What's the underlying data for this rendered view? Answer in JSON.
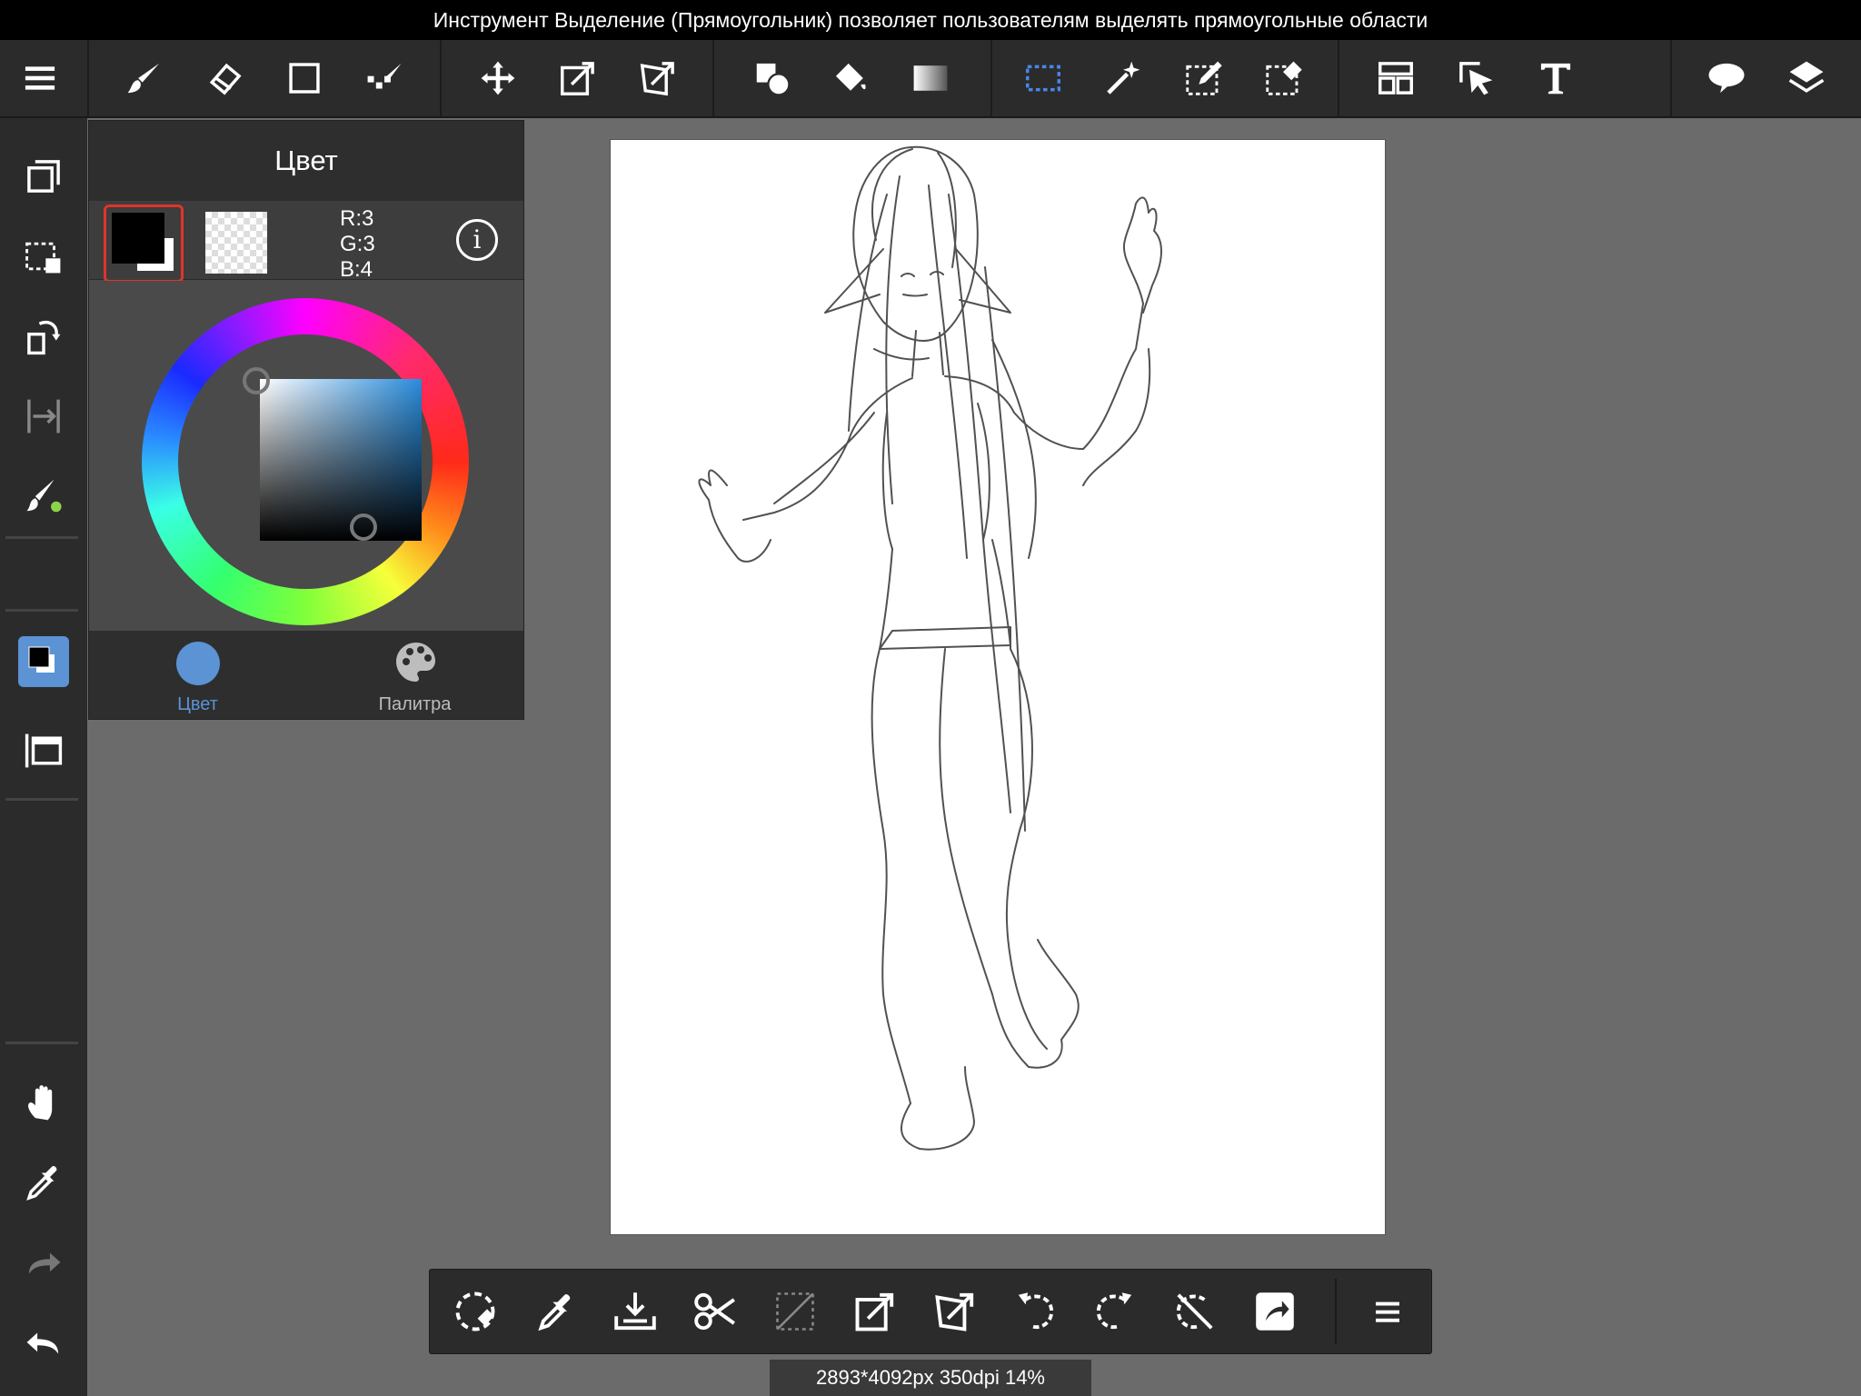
{
  "hint_bar": {
    "text": "Инструмент Выделение (Прямоугольник) позволяет пользователям выделять прямоугольные области"
  },
  "toolbar": {
    "tools": [
      "menu-icon",
      "brush-icon",
      "eraser-icon",
      "shape-icon",
      "dot-brush-icon",
      "move-icon",
      "transform-icon",
      "free-transform-icon",
      "fill-shape-icon",
      "bucket-icon",
      "gradient-icon",
      "select-rect-icon",
      "magic-wand-icon",
      "select-pen-icon",
      "select-eraser-icon",
      "frame-divider-icon",
      "operation-icon",
      "text-icon",
      "speech-bubble-icon",
      "layers-icon"
    ]
  },
  "color_panel": {
    "title": "Цвет",
    "rgb": {
      "r": "R:3",
      "g": "G:3",
      "b": "B:4"
    },
    "info_label": "i",
    "tabs": {
      "color": "Цвет",
      "palette": "Палитра"
    },
    "active_tab_color": "#5b93d4",
    "fg_color": "#030304"
  },
  "selection_bar": {
    "tools": [
      "deselect-icon",
      "eyedropper-icon",
      "import-icon",
      "cut-icon",
      "clear-icon",
      "transform-icon",
      "free-transform-icon",
      "rotate-left-icon",
      "rotate-right-icon",
      "no-rotate-icon",
      "share-icon",
      "more-icon"
    ]
  },
  "status_bar": {
    "text": "2893*4092px 350dpi 14%"
  }
}
